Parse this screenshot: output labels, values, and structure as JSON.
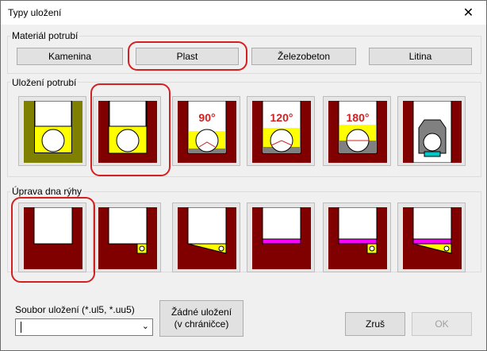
{
  "window": {
    "title": "Typy uložení",
    "close_glyph": "✕"
  },
  "material": {
    "label": "Materiál potrubí",
    "buttons": [
      "Kamenina",
      "Plast",
      "Železobeton",
      "Litina"
    ]
  },
  "bedding": {
    "label": "Uložení potrubí",
    "angle_labels": [
      "90°",
      "120°",
      "180°"
    ]
  },
  "trench": {
    "label": "Úprava dna rýhy"
  },
  "file": {
    "label": "Soubor uložení (*.ul5, *.uu5)",
    "value": ""
  },
  "buttons": {
    "none_line1": "Žádné uložení",
    "none_line2": "(v chráničce)",
    "cancel": "Zruš",
    "ok": "OK"
  },
  "colors": {
    "dark_red": "#800000",
    "yellow": "#ffff00",
    "olive": "#808000",
    "magenta": "#ff00ff",
    "gray": "#808080",
    "cyan": "#00c8c8",
    "highlight": "#d32020"
  }
}
